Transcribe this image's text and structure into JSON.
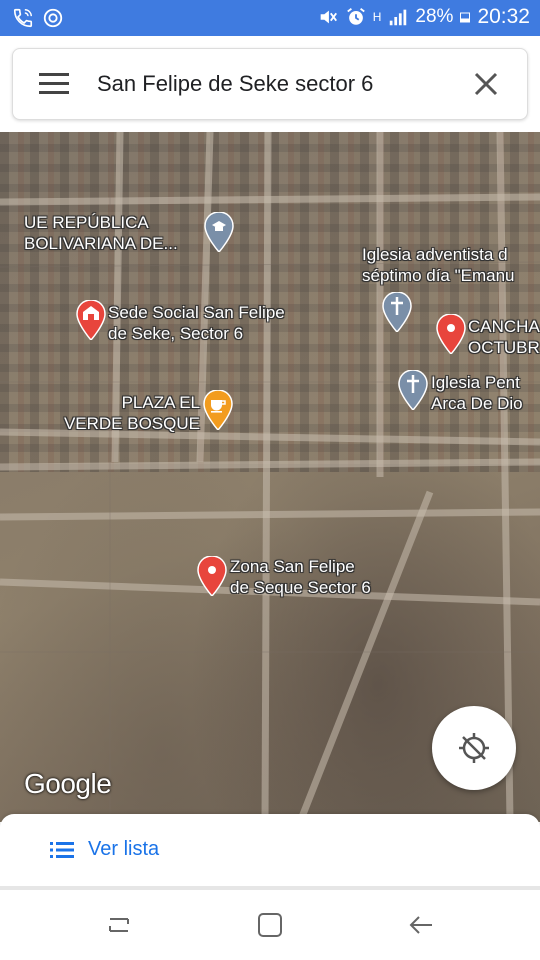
{
  "status_bar": {
    "battery": "28%",
    "time": "20:32",
    "network": "H"
  },
  "search": {
    "query": "San Felipe de Seke sector 6"
  },
  "map": {
    "places": [
      {
        "id": "school",
        "label": "UE REPÚBLICA\nBOLIVARIANA DE...",
        "icon": "school-icon",
        "color": "#7a8fa8"
      },
      {
        "id": "church1",
        "label": "Iglesia adventista d\nséptimo día \"Emanu",
        "icon": "church-icon",
        "color": "#7a8fa8"
      },
      {
        "id": "sede",
        "label": "Sede Social San Felipe\nde Seke, Sector 6",
        "icon": "civic-building-icon",
        "color": "#e8453c"
      },
      {
        "id": "cancha",
        "label": "CANCHA\nOCTUBR",
        "icon": "location-pin-icon",
        "color": "#e8453c"
      },
      {
        "id": "church2",
        "label": "Iglesia Pent\nArca De Dio",
        "icon": "church-icon",
        "color": "#7a8fa8"
      },
      {
        "id": "plaza",
        "label": "PLAZA EL\nVERDE BOSQUE",
        "icon": "cafe-icon",
        "color": "#f29c1f"
      },
      {
        "id": "zona",
        "label": "Zona San Felipe\nde Seque Sector 6",
        "icon": "location-pin-icon",
        "color": "#e8453c"
      }
    ],
    "logo": "Google"
  },
  "bottom_sheet": {
    "list_label": "Ver lista"
  }
}
